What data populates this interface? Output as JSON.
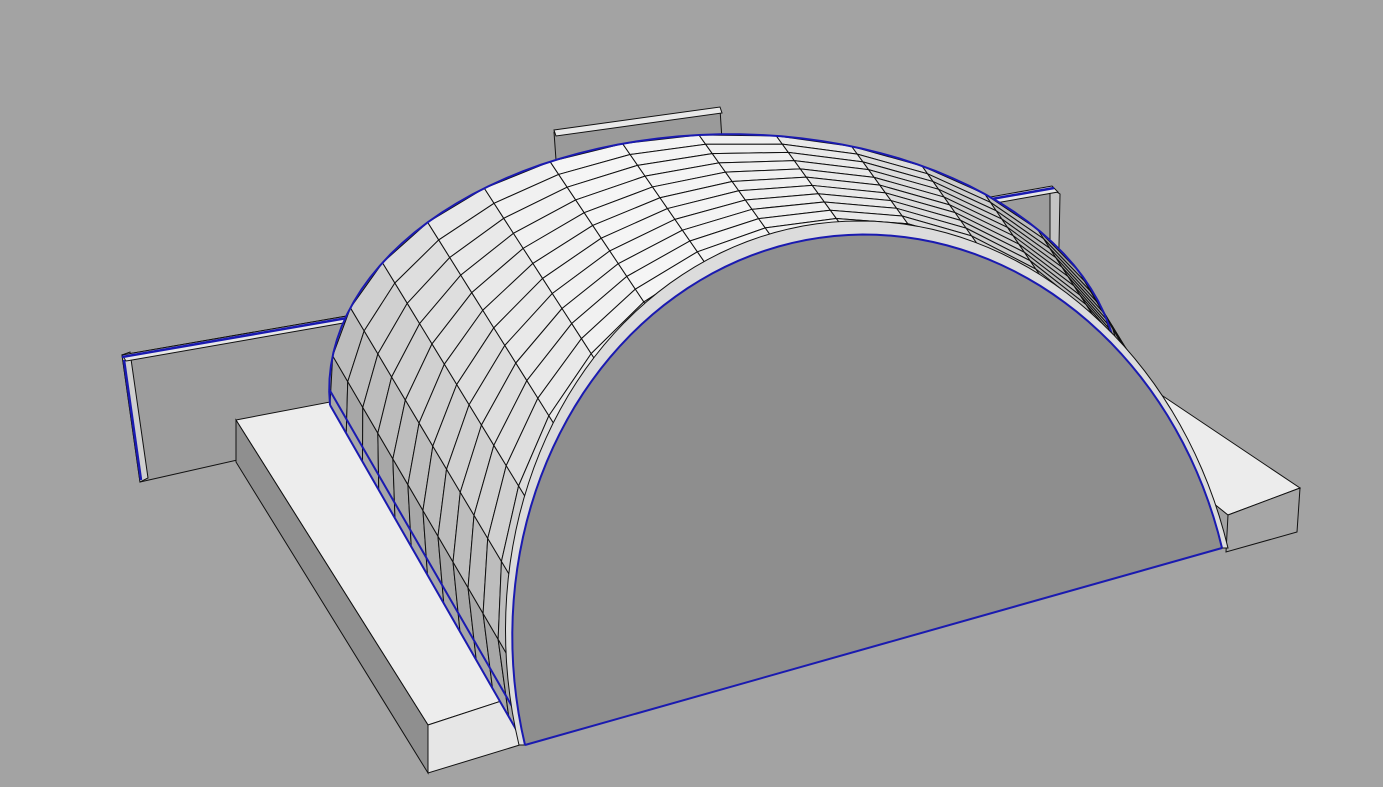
{
  "viewport": {
    "background": "#a3a3a3",
    "shading_mode": "shaded-with-edges"
  },
  "model": {
    "elements": [
      "left-wall",
      "right-wall",
      "back-wall",
      "front-ledge",
      "right-ledge",
      "barrel-vault-roof",
      "vault-end-gable"
    ],
    "roof": {
      "arch_divisions": 16,
      "longitudinal_divisions": 12
    },
    "colors": {
      "face_light": "#f2f2f2",
      "face_mid": "#dcdcdc",
      "face_dark": "#8e8e8e",
      "edge": "#101010",
      "highlight_edge": "#1a1ab0"
    }
  }
}
